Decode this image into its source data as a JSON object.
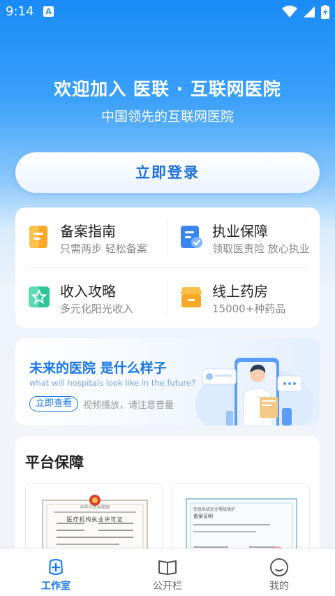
{
  "status_bar": {
    "time": "9:14",
    "app_badge": "A"
  },
  "hero": {
    "title": "欢迎加入 医联 · 互联网医院",
    "subtitle": "中国领先的互联网医院"
  },
  "login_button": "立即登录",
  "services": [
    {
      "title": "备案指南",
      "subtitle": "只需两步 轻松备案",
      "icon": "document-icon",
      "color": "#f7a928"
    },
    {
      "title": "执业保障",
      "subtitle": "领取医责险 放心执业",
      "icon": "shield-check-icon",
      "color": "#3a86f0"
    },
    {
      "title": "收入攻略",
      "subtitle": "多元化阳光收入",
      "icon": "star-card-icon",
      "color": "#2ec79a"
    },
    {
      "title": "线上药房",
      "subtitle": "15000+种药品",
      "icon": "store-icon",
      "color": "#f7b32b"
    }
  ],
  "promo": {
    "title": "未来的医院 是什么样子",
    "subtitle_en": "what will hospitals look like in the future?",
    "button": "立即查看",
    "note": "视频播放，请注意音量"
  },
  "platform": {
    "title": "平台保障",
    "certificates": [
      {
        "header": "中华人民共和国",
        "name": "医疗机构执业许可证"
      },
      {
        "header": "信息系统安全等级保护",
        "name": "备案证明"
      }
    ]
  },
  "tabs": [
    {
      "label": "工作室",
      "icon": "plus-circle-icon",
      "active": true
    },
    {
      "label": "公开栏",
      "icon": "open-book-icon",
      "active": false
    },
    {
      "label": "我的",
      "icon": "smiley-face-icon",
      "active": false
    }
  ]
}
